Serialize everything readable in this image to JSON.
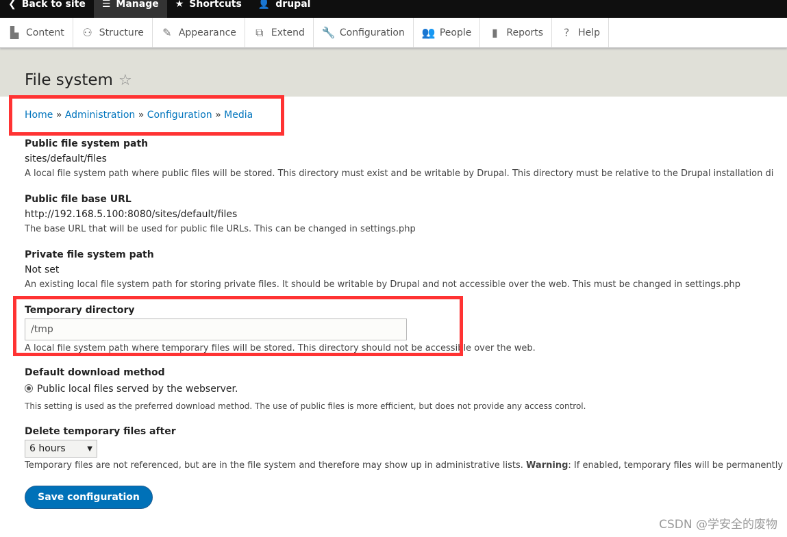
{
  "toolbar": {
    "back": "Back to site",
    "manage": "Manage",
    "shortcuts": "Shortcuts",
    "user": "drupal"
  },
  "tray": [
    {
      "label": "Content",
      "icon": "page-icon"
    },
    {
      "label": "Structure",
      "icon": "sitemap-icon"
    },
    {
      "label": "Appearance",
      "icon": "paintbrush-icon"
    },
    {
      "label": "Extend",
      "icon": "puzzle-icon"
    },
    {
      "label": "Configuration",
      "icon": "wrench-icon"
    },
    {
      "label": "People",
      "icon": "people-icon"
    },
    {
      "label": "Reports",
      "icon": "bar-chart-icon"
    },
    {
      "label": "Help",
      "icon": "help-icon"
    }
  ],
  "page": {
    "title": "File system"
  },
  "breadcrumb": [
    "Home",
    "Administration",
    "Configuration",
    "Media"
  ],
  "fields": {
    "public_path": {
      "label": "Public file system path",
      "value": "sites/default/files",
      "desc": "A local file system path where public files will be stored. This directory must exist and be writable by Drupal. This directory must be relative to the Drupal installation di"
    },
    "public_url": {
      "label": "Public file base URL",
      "value": "http://192.168.5.100:8080/sites/default/files",
      "desc": "The base URL that will be used for public file URLs. This can be changed in settings.php"
    },
    "private_path": {
      "label": "Private file system path",
      "value": "Not set",
      "desc": "An existing local file system path for storing private files. It should be writable by Drupal and not accessible over the web. This must be changed in settings.php"
    },
    "temp_dir": {
      "label": "Temporary directory",
      "value": "/tmp",
      "desc": "A local file system path where temporary files will be stored. This directory should not be accessible over the web."
    },
    "download": {
      "label": "Default download method",
      "option": "Public local files served by the webserver.",
      "desc": "This setting is used as the preferred download method. The use of public files is more efficient, but does not provide any access control."
    },
    "delete_temp": {
      "label": "Delete temporary files after",
      "value": "6 hours",
      "desc": "Temporary files are not referenced, but are in the file system and therefore may show up in administrative lists.",
      "warning": "Warning",
      "desc2": ": If enabled, temporary files will be permanently"
    }
  },
  "save": "Save configuration",
  "watermark": "CSDN @学安全的废物"
}
